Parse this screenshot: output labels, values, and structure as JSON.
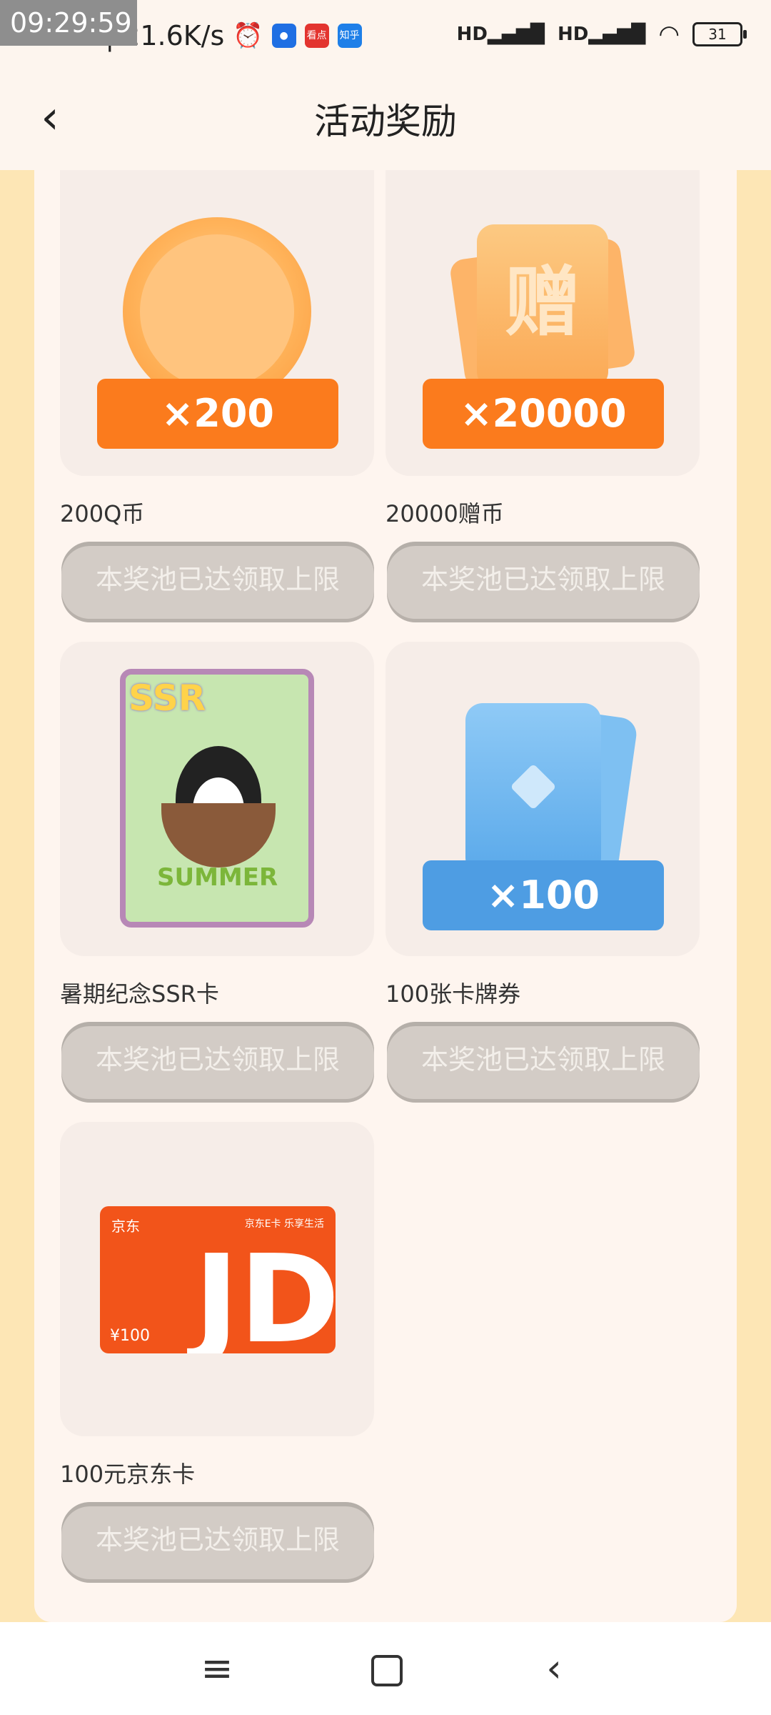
{
  "status_bar": {
    "clock_overlay": "09:29:59",
    "time": "9:29",
    "speed": "21.6K/s",
    "battery": "31",
    "signal1": "HD",
    "signal2": "HD",
    "app_icons": [
      "alarm-icon",
      "app-icon-blue",
      "kandian-icon",
      "zhihu-icon"
    ],
    "app_kandian": "看点",
    "app_zhihu": "知乎"
  },
  "header": {
    "back_icon": "chevron-left-icon",
    "title": "活动奖励"
  },
  "rewards": [
    {
      "label": "200Q币",
      "badge": "×200",
      "badge_color": "#fb7b1d",
      "button": "本奖池已达领取上限"
    },
    {
      "label": "20000赠币",
      "badge": "×20000",
      "badge_color": "#fb7b1d",
      "ticket_char": "赠",
      "button": "本奖池已达领取上限"
    },
    {
      "label": "暑期纪念SSR卡",
      "ssr_tag": "SSR",
      "ssr_text": "SUMMER",
      "button": "本奖池已达领取上限"
    },
    {
      "label": "100张卡牌券",
      "badge": "×100",
      "badge_color": "#4e9de3",
      "button": "本奖池已达领取上限"
    },
    {
      "label": "100元京东卡",
      "jd_brand": "京东",
      "jd_small": "京东E卡 乐享生活",
      "jd_amount": "¥100",
      "jd_logo": "JD",
      "button": "本奖池已达领取上限"
    }
  ],
  "nav": {
    "menu_icon": "menu-icon",
    "home_icon": "home-icon",
    "back_icon": "back-icon"
  }
}
